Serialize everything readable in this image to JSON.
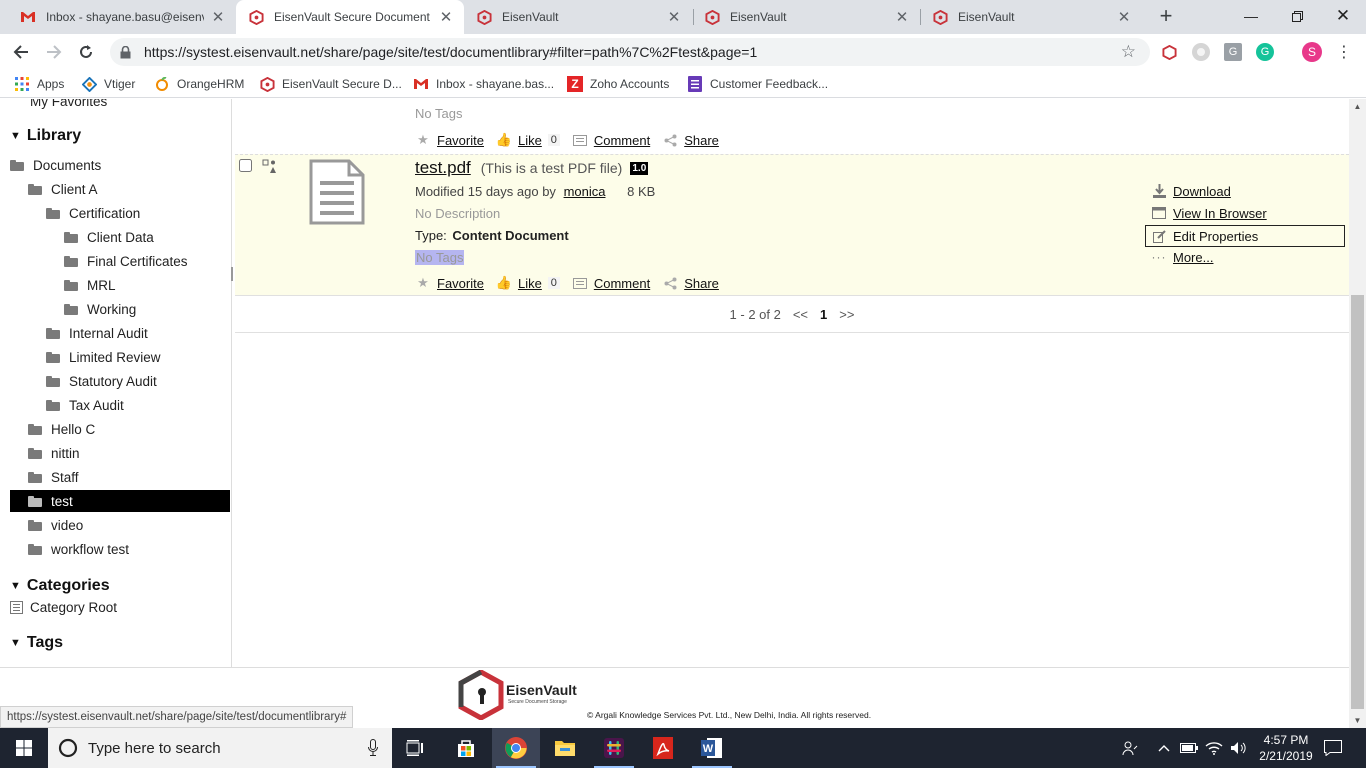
{
  "browser": {
    "tabs": [
      {
        "title": "Inbox - shayane.basu@eisenva",
        "icon": "gmail-icon"
      },
      {
        "title": "EisenVault Secure Document St",
        "icon": "eisenvault-icon",
        "active": true
      },
      {
        "title": "EisenVault",
        "icon": "eisenvault-icon"
      },
      {
        "title": "EisenVault",
        "icon": "eisenvault-icon"
      },
      {
        "title": "EisenVault",
        "icon": "eisenvault-icon"
      }
    ],
    "new_tab": "+",
    "url": "https://systest.eisenvault.net/share/page/site/test/documentlibrary#filter=path%7C%2Ftest&page=1",
    "profile_initial": "S",
    "bookmarks": [
      {
        "label": "Apps",
        "icon": "apps-grid-icon"
      },
      {
        "label": "Vtiger",
        "icon": "vtiger-icon"
      },
      {
        "label": "OrangeHRM",
        "icon": "orangehrm-icon"
      },
      {
        "label": "EisenVault Secure D...",
        "icon": "eisenvault-icon"
      },
      {
        "label": "Inbox - shayane.bas...",
        "icon": "gmail-icon"
      },
      {
        "label": "Zoho Accounts",
        "icon": "zoho-icon"
      },
      {
        "label": "Customer Feedback...",
        "icon": "forms-icon"
      }
    ]
  },
  "sidebar": {
    "top_cutoff": "My Favorites",
    "library_heading": "Library",
    "tree": [
      {
        "label": "Documents",
        "level": 0
      },
      {
        "label": "Client A",
        "level": 1
      },
      {
        "label": "Certification",
        "level": 2
      },
      {
        "label": "Client Data",
        "level": 3
      },
      {
        "label": "Final Certificates",
        "level": 3
      },
      {
        "label": "MRL",
        "level": 3
      },
      {
        "label": "Working",
        "level": 3
      },
      {
        "label": "Internal Audit",
        "level": 2
      },
      {
        "label": "Limited Review",
        "level": 2
      },
      {
        "label": "Statutory Audit",
        "level": 2
      },
      {
        "label": "Tax Audit",
        "level": 2
      },
      {
        "label": "Hello C",
        "level": 1
      },
      {
        "label": "nittin",
        "level": 1
      },
      {
        "label": "Staff",
        "level": 1
      },
      {
        "label": "test",
        "level": 1,
        "selected": true
      },
      {
        "label": "video",
        "level": 1
      },
      {
        "label": "workflow test",
        "level": 1
      }
    ],
    "categories_heading": "Categories",
    "category_root": "Category Root",
    "tags_heading": "Tags"
  },
  "previous_item": {
    "tags": "No Tags",
    "favorite": "Favorite",
    "like": "Like",
    "like_count": "0",
    "comment": "Comment",
    "share": "Share"
  },
  "document": {
    "name": "test.pdf",
    "title": "(This is a test PDF file)",
    "version": "1.0",
    "modified_prefix": "Modified 15 days ago by",
    "modified_by": "monica",
    "size": "8 KB",
    "description": "No Description",
    "type_label": "Type:",
    "type_value": "Content Document",
    "tags": "No Tags",
    "favorite": "Favorite",
    "like": "Like",
    "like_count": "0",
    "comment": "Comment",
    "share": "Share",
    "actions": {
      "download": "Download",
      "view_in_browser": "View In Browser",
      "edit_properties": "Edit Properties",
      "more": "More..."
    }
  },
  "pager": {
    "range": "1 - 2 of 2",
    "prev": "<<",
    "current": "1",
    "next": ">>"
  },
  "footer": {
    "brand": "EisenVault",
    "tagline": "Secure Document Storage",
    "copyright": "© Argali Knowledge Services Pvt. Ltd., New Delhi, India. All rights reserved.",
    "status_url": "https://systest.eisenvault.net/share/page/site/test/documentlibrary#"
  },
  "taskbar": {
    "search_placeholder": "Type here to search",
    "time": "4:57 PM",
    "date": "2/21/2019"
  },
  "colors": {
    "selected_bg": "#000000",
    "row_highlight": "#fdfde9",
    "brand_red": "#c8323a",
    "taskbar_bg": "#1e2430"
  }
}
